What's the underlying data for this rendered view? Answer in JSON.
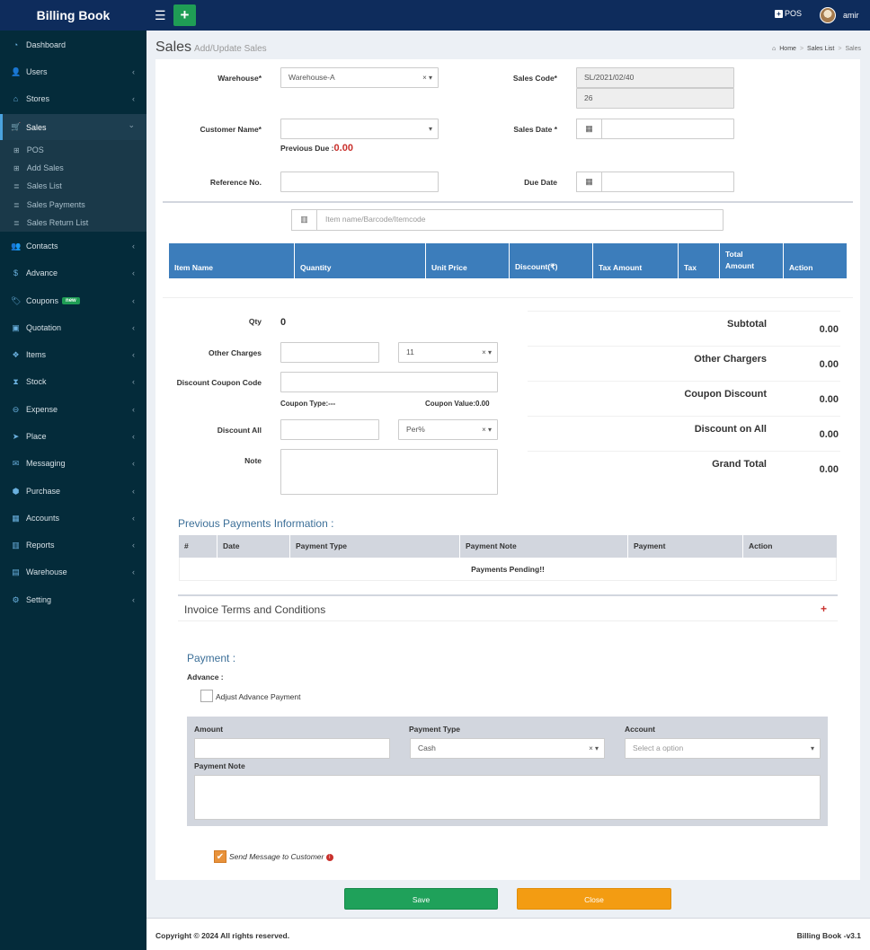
{
  "header": {
    "brand": "Billing Book",
    "menu_icon": "☰",
    "add_icon": "+",
    "pos_label": "POS",
    "user_name": "amir",
    "colors": {
      "bar": "#0e2c5c",
      "add_button": "#1f9d55"
    }
  },
  "sidebar": {
    "items": [
      {
        "label": "Dashboard",
        "icon": "dashboard-icon",
        "glyph": "◔"
      },
      {
        "label": "Users",
        "icon": "users-icon",
        "glyph": "👤"
      },
      {
        "label": "Stores",
        "icon": "store-icon",
        "glyph": "⌂"
      },
      {
        "label": "Sales",
        "icon": "cart-icon",
        "glyph": "🛒"
      },
      {
        "label": "Contacts",
        "icon": "contacts-icon",
        "glyph": "👥"
      },
      {
        "label": "Advance",
        "icon": "dollar-icon",
        "glyph": "$"
      },
      {
        "label": "Coupons",
        "icon": "tag-icon",
        "glyph": "🏷",
        "badge": "new"
      },
      {
        "label": "Quotation",
        "icon": "calendar-icon",
        "glyph": "▣"
      },
      {
        "label": "Items",
        "icon": "cubes-icon",
        "glyph": "❖"
      },
      {
        "label": "Stock",
        "icon": "hourglass-icon",
        "glyph": "⧗"
      },
      {
        "label": "Expense",
        "icon": "minus-circle-icon",
        "glyph": "⊖"
      },
      {
        "label": "Place",
        "icon": "paper-plane-icon",
        "glyph": "➤"
      },
      {
        "label": "Messaging",
        "icon": "envelope-icon",
        "glyph": "✉"
      },
      {
        "label": "Purchase",
        "icon": "cube-icon",
        "glyph": "⬢"
      },
      {
        "label": "Accounts",
        "icon": "grid-icon",
        "glyph": "▦"
      },
      {
        "label": "Reports",
        "icon": "bar-chart-icon",
        "glyph": "▥"
      },
      {
        "label": "Warehouse",
        "icon": "building-icon",
        "glyph": "▤"
      },
      {
        "label": "Setting",
        "icon": "cogs-icon",
        "glyph": "⚙"
      }
    ],
    "sales_sub": [
      {
        "label": "POS",
        "glyph": "⊞"
      },
      {
        "label": "Add Sales",
        "glyph": "⊞"
      },
      {
        "label": "Sales List",
        "glyph": "≣"
      },
      {
        "label": "Sales Payments",
        "glyph": "≣"
      },
      {
        "label": "Sales Return List",
        "glyph": "≣"
      }
    ],
    "chevron_right": "‹",
    "chevron_down": "⌄"
  },
  "page": {
    "title": "Sales",
    "subtitle": "Add/Update Sales",
    "breadcrumb": [
      "Home",
      "Sales List",
      "Sales"
    ]
  },
  "form": {
    "warehouse_label": "Warehouse*",
    "warehouse_value": "Warehouse-A",
    "sales_code_label": "Sales Code*",
    "sales_code_value": "SL/2021/02/40",
    "sales_code_num": "26",
    "customer_label": "Customer Name*",
    "customer_value": "",
    "previous_due_label": "Previous Due :",
    "previous_due_value": "0.00",
    "sales_date_label": "Sales Date *",
    "reference_label": "Reference No.",
    "due_date_label": "Due Date",
    "item_search_placeholder": "Item name/Barcode/Itemcode",
    "clear_icon": "×",
    "caret_icon": "▾",
    "calendar_glyph": "▦",
    "barcode_glyph": "▥"
  },
  "items_table": {
    "headers": [
      "Item Name",
      "Quantity",
      "Unit Price",
      "Discount(₹)",
      "Tax Amount",
      "Tax",
      "Total\nAmount",
      "Action"
    ]
  },
  "charges": {
    "qty_label": "Qty",
    "qty_value": "0",
    "other_charges_label": "Other Charges",
    "other_charges_value": "",
    "other_charges_tax": "11",
    "coupon_label": "Discount Coupon Code",
    "coupon_type": "Coupon Type:---",
    "coupon_value": "Coupon Value:0.00",
    "discount_all_label": "Discount All",
    "discount_type": "Per%",
    "note_label": "Note"
  },
  "summary": [
    {
      "label": "Subtotal",
      "value": "0.00"
    },
    {
      "label": "Other Chargers",
      "value": "0.00"
    },
    {
      "label": "Coupon Discount",
      "value": "0.00"
    },
    {
      "label": "Discount on All",
      "value": "0.00"
    },
    {
      "label": "Grand Total",
      "value": "0.00"
    }
  ],
  "previous_payments": {
    "title": "Previous Payments Information :",
    "headers": [
      "#",
      "Date",
      "Payment Type",
      "Payment Note",
      "Payment",
      "Action"
    ],
    "empty_message": "Payments Pending!!"
  },
  "terms": {
    "title": "Invoice Terms and Conditions",
    "expand_icon": "+"
  },
  "payment": {
    "title": "Payment :",
    "advance_label": "Advance :",
    "adjust_label": "Adjust Advance Payment",
    "amount_label": "Amount",
    "payment_type_label": "Payment Type",
    "payment_type_value": "Cash",
    "account_label": "Account",
    "account_placeholder": "Select a option",
    "note_label": "Payment Note",
    "send_message_label": "Send Message to Customer",
    "check_glyph": "✔",
    "info_glyph": "i"
  },
  "actions": {
    "save": "Save",
    "close": "Close",
    "colors": {
      "save": "#1fa15a",
      "close": "#f39c12"
    }
  },
  "footer": {
    "copyright": "Copyright © 2024 All rights reserved.",
    "version": "Billing Book -v3.1"
  }
}
